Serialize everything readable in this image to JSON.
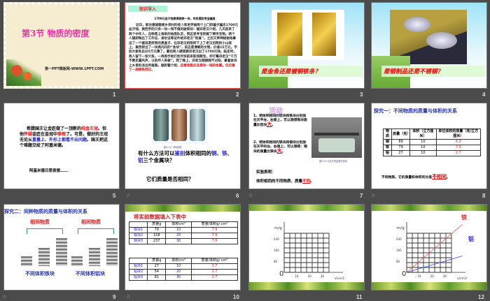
{
  "slides": [
    {
      "number": "1",
      "title": "第3节  物质的密度",
      "footer": "第一PPT模板网-WWW.1PPT.COM"
    },
    {
      "number": "2",
      "heading": "知识导入",
      "headline": "1700元血汗钱换得假铁一块，市民提防寻宝骗局",
      "body": "近日，家住德城稳楼乡郊村的老人和老伴被两个上门的骗子骗走1700元血汗钱。换回手的只有一块一钱不值的破铁块！据邓老汉介绍，几天前来了两个中年人，自称是上海来的地质队员，到这里寻宝挖掘了稀世宝物。两个人随即掏出了工作证、身份证等证件给邓老汉“检查”。之后又神神秘秘地拿出了一个据说是挖到的黑盒子，在邓老汉的陪同下上了老汉后院的小山坡上，果然挖出了一块亮闪闪的“金块”，说这是清朝的文物，价值15万元。不如大家各自分5万元算了。最后两人硬是要邓老汉出了1700元钱。临走时，两人留下一张欠条。一再表示他们会尽快前来取钱赎宝。并叮嘱邓老汉“千万不要走漏风声，以防坏人来偷”。到了晚上，邓老汉越想越不对劲，拿着金块上乡里的派出所报案。据民警介绍，",
      "body_red": "这哪里是应该是块一钱的金属，仅仅镀了一层铜铁而已。"
    },
    {
      "number": "3",
      "caption": "是金条还是镀铜铁条？"
    },
    {
      "number": "4",
      "caption": "是银制品还是不锈钢？"
    },
    {
      "number": "5",
      "p1": "希腊国王让金匠做了一顶新的",
      "p1_red": "纯金王冠",
      "p2": "。但他",
      "p2_red": "怀疑",
      "p3": "金匠在金冠中",
      "p3_red": "掺假",
      "p4": "了。可是，做好的王冠无论从",
      "p4_blue": "重量上、外形上都看不出问题",
      "p5": "。国王把这个难题交给了阿基米德。",
      "p6": "阿基米德日思夜想……"
    },
    {
      "number": "6",
      "img_caption": "图4-22  3种金属",
      "q1a": "有什么方法可以",
      "q1_blue": "鉴别",
      "q1b": "体积相同的",
      "q1_metals": "铜、铁、铝",
      "q1c": "三个金属块？",
      "q2": "它们质量是否相同？"
    },
    {
      "number": "7",
      "activity": "活动",
      "item1": "1、把体积相同的铝块和铁块分别放在天平左、右盘上，可以测得铁块质量比铝块",
      "item1_ans": "大",
      "item2": "2、把体积相同的铁块和铜块分别放在天平的左、右盘上，可以测得：铜块的质量比铁块",
      "item2_ans": "大",
      "img_caption": "图4-33  比较不同金属的质量",
      "conclusion_label": "实验表明：",
      "conclusion": "体积相同的不同物质，质量",
      "conclusion_ans": "不同"
    },
    {
      "number": "8",
      "title": "探究一：不同物质的质量与体积的关系",
      "headers": [
        "物质",
        "质量（克）",
        "体积（立方厘米）",
        "单位体积的质量（克/立方厘米）"
      ],
      "rows": [
        [
          "铜",
          "89",
          "10",
          "8.9"
        ],
        [
          "铁",
          "79",
          "10",
          "7.9"
        ],
        [
          "铝",
          "27",
          "10",
          "2.7"
        ]
      ],
      "conclusion": "不同物质，它的质量和体积的比值",
      "conclusion_ans": "不相同"
    },
    {
      "number": "9",
      "title": "探究二：同种物质的质量与体积的关系",
      "label_left": "相同物质",
      "label_right": "相同物质",
      "caption_left": "不同体积铁块",
      "caption_right": "不同体积铝块"
    },
    {
      "number": "10",
      "title": "将实验数据填入下表中",
      "headers": [
        "",
        "质量g",
        "体积cm³",
        "质量/体积g/ cm³"
      ],
      "iron_rows": [
        [
          "铁块1",
          "79",
          "10",
          "7.9"
        ],
        [
          "铁块2",
          "158",
          "20",
          "7.9"
        ],
        [
          "铁块3",
          "237",
          "30",
          "7.9"
        ]
      ],
      "al_rows": [
        [
          "铝块1",
          "27",
          "10",
          "2.7"
        ],
        [
          "铝块2",
          "54",
          "20",
          "2.7"
        ],
        [
          "铝块3",
          "81",
          "30",
          "2.7"
        ]
      ]
    },
    {
      "number": "11"
    },
    {
      "number": "12",
      "iron_label": "铁",
      "al_label": "铝"
    }
  ],
  "chart_data": [
    {
      "type": "line",
      "ylabel": "m/g",
      "xlabel": "v/cm3",
      "origin": "0",
      "yticks": [
        "80",
        "160",
        "240"
      ],
      "xticks": [
        "10",
        "20",
        "30"
      ],
      "xlim": [
        0,
        35
      ],
      "ylim": [
        0,
        280
      ],
      "series": []
    },
    {
      "type": "line",
      "ylabel": "m/g",
      "xlabel": "v/cm3",
      "origin": "0",
      "yticks": [
        "80",
        "160",
        "240"
      ],
      "xticks": [
        "10",
        "20",
        "30"
      ],
      "xlim": [
        0,
        35
      ],
      "ylim": [
        0,
        280
      ],
      "series": [
        {
          "name": "铁",
          "color": "#f06060",
          "x": [
            0,
            10,
            20,
            30
          ],
          "y": [
            0,
            79,
            158,
            237
          ]
        },
        {
          "name": "铝",
          "color": "#4040ff",
          "x": [
            0,
            10,
            20,
            30
          ],
          "y": [
            0,
            27,
            54,
            81
          ]
        }
      ]
    }
  ],
  "anim_marker": "☆"
}
